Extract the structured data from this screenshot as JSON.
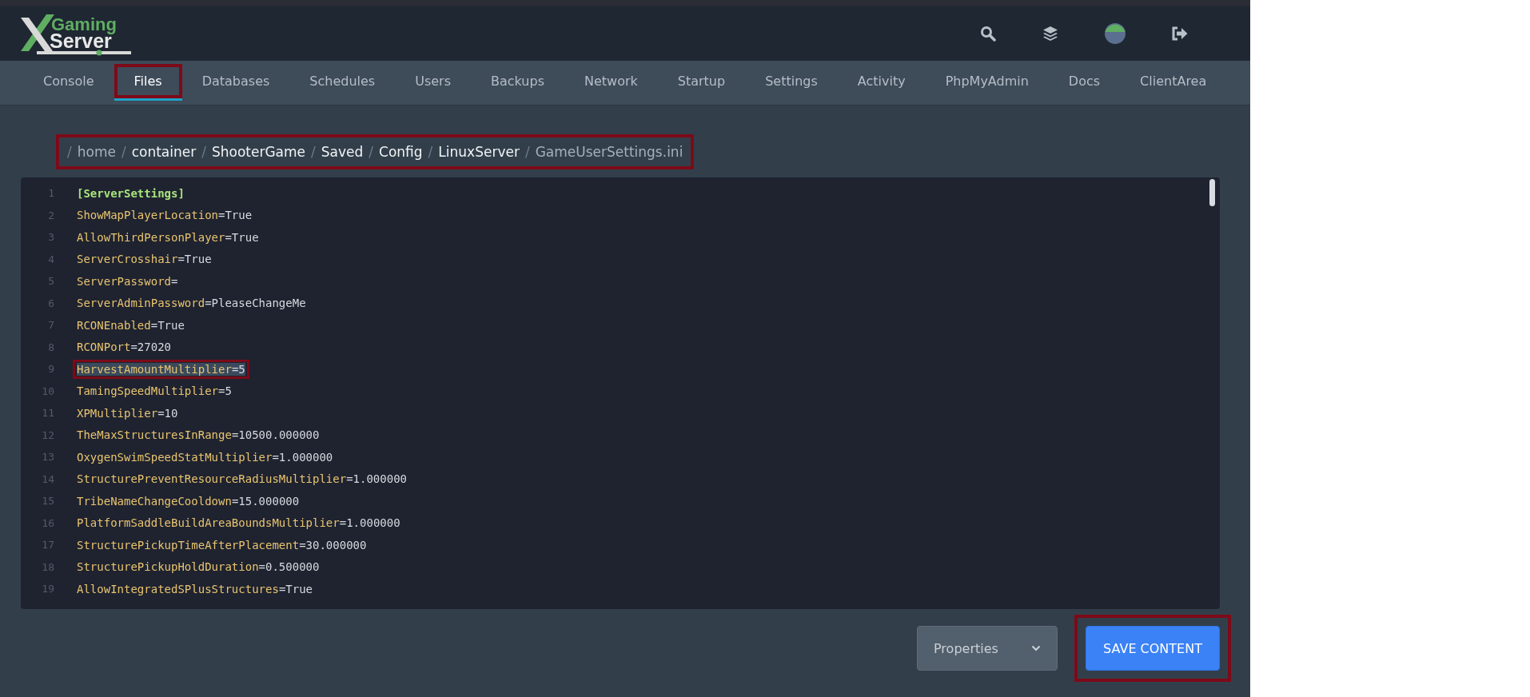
{
  "logo": {
    "line1": "Gaming",
    "line2": "Server"
  },
  "tabs": [
    {
      "label": "Console",
      "selected": false,
      "highlighted": false
    },
    {
      "label": "Files",
      "selected": true,
      "highlighted": true
    },
    {
      "label": "Databases",
      "selected": false,
      "highlighted": false
    },
    {
      "label": "Schedules",
      "selected": false,
      "highlighted": false
    },
    {
      "label": "Users",
      "selected": false,
      "highlighted": false
    },
    {
      "label": "Backups",
      "selected": false,
      "highlighted": false
    },
    {
      "label": "Network",
      "selected": false,
      "highlighted": false
    },
    {
      "label": "Startup",
      "selected": false,
      "highlighted": false
    },
    {
      "label": "Settings",
      "selected": false,
      "highlighted": false
    },
    {
      "label": "Activity",
      "selected": false,
      "highlighted": false
    },
    {
      "label": "PhpMyAdmin",
      "selected": false,
      "highlighted": false
    },
    {
      "label": "Docs",
      "selected": false,
      "highlighted": false
    },
    {
      "label": "ClientArea",
      "selected": false,
      "highlighted": false
    }
  ],
  "breadcrumb": {
    "highlighted": true,
    "separators": [
      "/",
      "/",
      "/",
      "/",
      "/",
      "/",
      "/"
    ],
    "segments": [
      {
        "label": "home",
        "link": false
      },
      {
        "label": "container",
        "link": true
      },
      {
        "label": "ShooterGame",
        "link": true
      },
      {
        "label": "Saved",
        "link": true
      },
      {
        "label": "Config",
        "link": true
      },
      {
        "label": "LinuxServer",
        "link": true
      },
      {
        "label": "GameUserSettings.ini",
        "link": false
      }
    ]
  },
  "editor": {
    "lines": [
      {
        "number": "1",
        "kind": "section",
        "key": "[ServerSettings]",
        "selected": false,
        "highlighted": false
      },
      {
        "number": "2",
        "kind": "setting",
        "key": "ShowMapPlayerLocation",
        "value": "=True",
        "selected": false,
        "highlighted": false
      },
      {
        "number": "3",
        "kind": "setting",
        "key": "AllowThirdPersonPlayer",
        "value": "=True",
        "selected": false,
        "highlighted": false
      },
      {
        "number": "4",
        "kind": "setting",
        "key": "ServerCrosshair",
        "value": "=True",
        "selected": false,
        "highlighted": false
      },
      {
        "number": "5",
        "kind": "setting",
        "key": "ServerPassword",
        "value": "=",
        "selected": false,
        "highlighted": false
      },
      {
        "number": "6",
        "kind": "setting",
        "key": "ServerAdminPassword",
        "value": "=PleaseChangeMe",
        "selected": false,
        "highlighted": false
      },
      {
        "number": "7",
        "kind": "setting",
        "key": "RCONEnabled",
        "value": "=True",
        "selected": false,
        "highlighted": false
      },
      {
        "number": "8",
        "kind": "setting",
        "key": "RCONPort",
        "value": "=27020",
        "selected": false,
        "highlighted": false
      },
      {
        "number": "9",
        "kind": "setting",
        "key": "HarvestAmountMultiplier",
        "value": "=5",
        "selected": true,
        "highlighted": true
      },
      {
        "number": "10",
        "kind": "setting",
        "key": "TamingSpeedMultiplier",
        "value": "=5",
        "selected": false,
        "highlighted": false
      },
      {
        "number": "11",
        "kind": "setting",
        "key": "XPMultiplier",
        "value": "=10",
        "selected": false,
        "highlighted": false
      },
      {
        "number": "12",
        "kind": "setting",
        "key": "TheMaxStructuresInRange",
        "value": "=10500.000000",
        "selected": false,
        "highlighted": false
      },
      {
        "number": "13",
        "kind": "setting",
        "key": "OxygenSwimSpeedStatMultiplier",
        "value": "=1.000000",
        "selected": false,
        "highlighted": false
      },
      {
        "number": "14",
        "kind": "setting",
        "key": "StructurePreventResourceRadiusMultiplier",
        "value": "=1.000000",
        "selected": false,
        "highlighted": false
      },
      {
        "number": "15",
        "kind": "setting",
        "key": "TribeNameChangeCooldown",
        "value": "=15.000000",
        "selected": false,
        "highlighted": false
      },
      {
        "number": "16",
        "kind": "setting",
        "key": "PlatformSaddleBuildAreaBoundsMultiplier",
        "value": "=1.000000",
        "selected": false,
        "highlighted": false
      },
      {
        "number": "17",
        "kind": "setting",
        "key": "StructurePickupTimeAfterPlacement",
        "value": "=30.000000",
        "selected": false,
        "highlighted": false
      },
      {
        "number": "18",
        "kind": "setting",
        "key": "StructurePickupHoldDuration",
        "value": "=0.500000",
        "selected": false,
        "highlighted": false
      },
      {
        "number": "19",
        "kind": "setting",
        "key": "AllowIntegratedSPlusStructures",
        "value": "=True",
        "selected": false,
        "highlighted": false
      }
    ]
  },
  "actions": {
    "dropdown": {
      "value": "Properties"
    },
    "save": {
      "label": "SAVE CONTENT",
      "highlighted": true
    }
  }
}
